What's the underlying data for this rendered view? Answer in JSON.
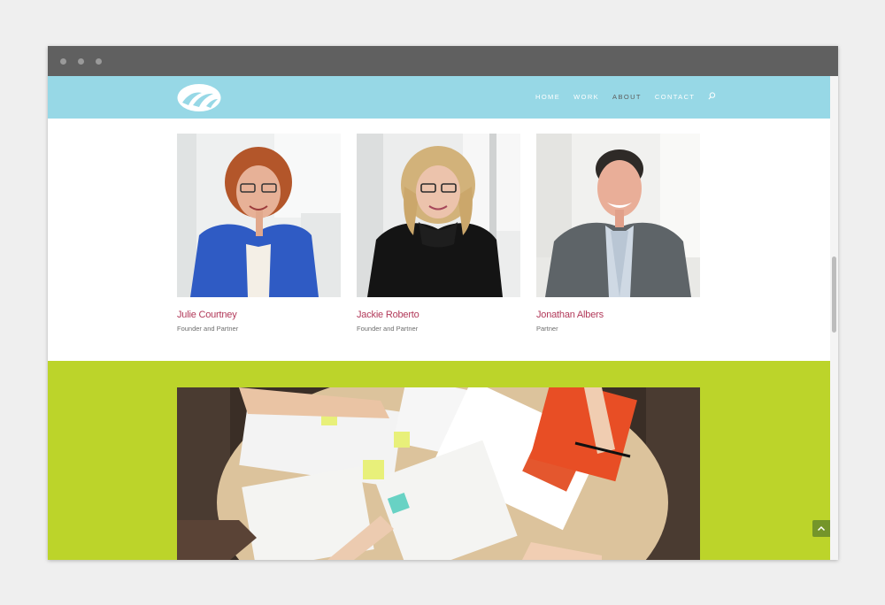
{
  "nav": {
    "items": [
      {
        "label": "HOME",
        "active": false
      },
      {
        "label": "WORK",
        "active": false
      },
      {
        "label": "ABOUT",
        "active": true
      },
      {
        "label": "CONTACT",
        "active": false
      }
    ]
  },
  "team": [
    {
      "name": "Julie Courtney",
      "role": "Founder and Partner"
    },
    {
      "name": "Jackie Roberto",
      "role": "Founder and Partner"
    },
    {
      "name": "Jonathan Albers",
      "role": "Partner"
    }
  ],
  "colors": {
    "header": "#97d8e6",
    "section_green": "#bcd42a",
    "accent_name": "#b23a5a",
    "nav_active": "#5d5d5d",
    "to_top_button": "#74952a"
  },
  "icons": [
    "logo-icon",
    "search-icon",
    "chevron-up-icon"
  ]
}
